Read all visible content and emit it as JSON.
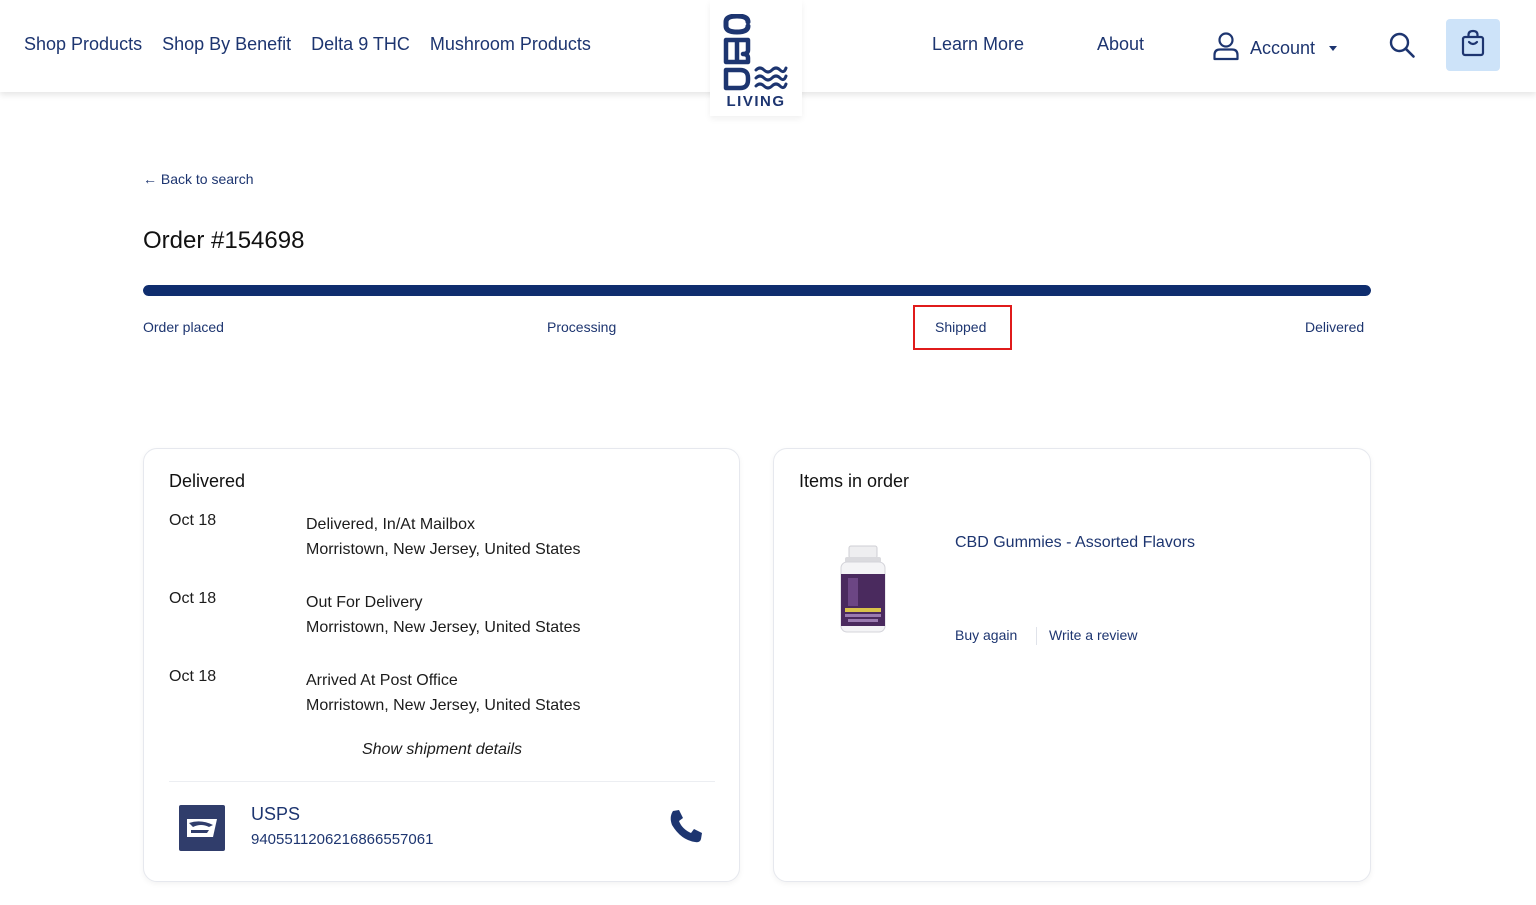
{
  "header": {
    "nav_left": [
      "Shop Products",
      "Shop By Benefit",
      "Delta 9 THC",
      "Mushroom Products"
    ],
    "logo_text": "CBD",
    "logo_sub": "LIVING",
    "learn_more": "Learn More",
    "about": "About",
    "account": "Account",
    "icons": {
      "account": "user-icon",
      "search": "search-icon",
      "cart": "shopping-bag-icon"
    }
  },
  "back_link": "← Back to search",
  "order": {
    "title": "Order #154698",
    "progress": 1.0,
    "steps": [
      "Order placed",
      "Processing",
      "Shipped",
      "Delivered"
    ],
    "highlighted_step": "Shipped"
  },
  "shipment_card": {
    "title": "Delivered",
    "events": [
      {
        "date": "Oct 18",
        "status": "Delivered, In/At Mailbox",
        "location": "Morristown, New Jersey, United States"
      },
      {
        "date": "Oct 18",
        "status": "Out For Delivery",
        "location": "Morristown, New Jersey, United States"
      },
      {
        "date": "Oct 18",
        "status": "Arrived At Post Office",
        "location": "Morristown, New Jersey, United States"
      }
    ],
    "show_details": "Show shipment details",
    "carrier": "USPS",
    "tracking_number": "9405511206216866557061"
  },
  "items_card": {
    "title": "Items in order",
    "product_name": "CBD Gummies - Assorted Flavors",
    "buy_again": "Buy again",
    "write_review": "Write a review"
  },
  "colors": {
    "brand_navy": "#1d3570",
    "progress_fill": "#0f2d6e",
    "cart_bg": "#cde3f9",
    "highlight": "#e01b1b"
  }
}
